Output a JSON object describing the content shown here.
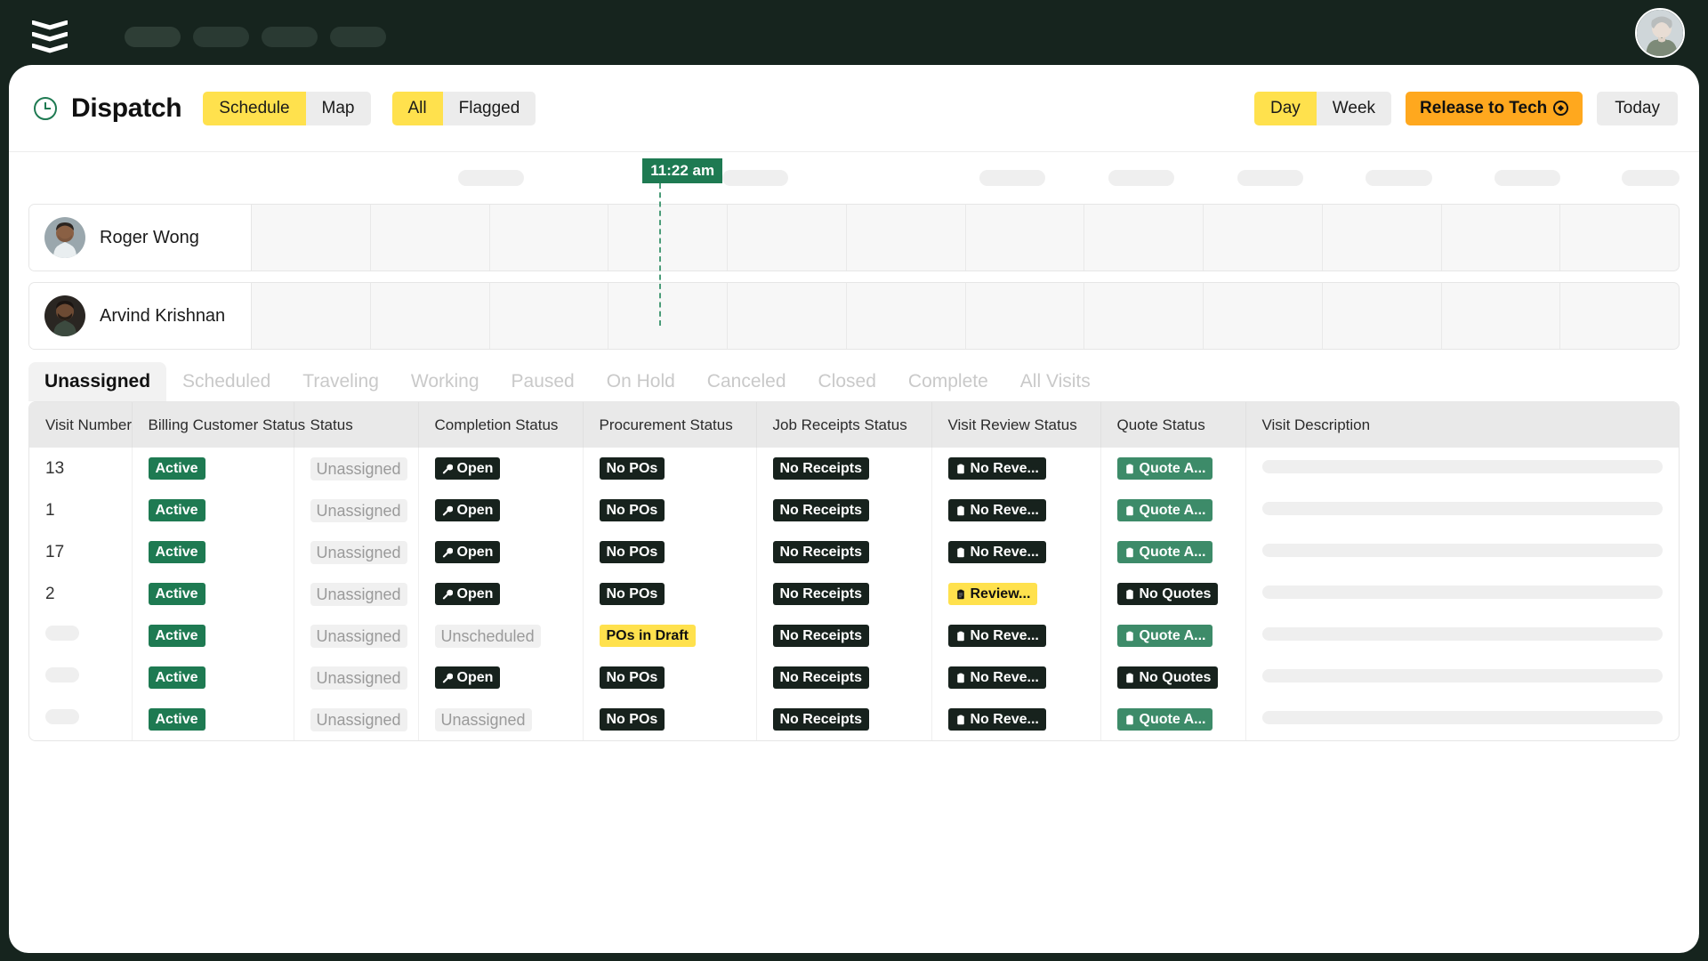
{
  "topbar": {
    "logo_name": "chevrons-logo",
    "nav_placeholders": 4,
    "avatar_label": "User avatar"
  },
  "header": {
    "clock_icon": "clock-icon",
    "title": "Dispatch",
    "view_toggle": {
      "options": [
        "Schedule",
        "Map"
      ],
      "selected": "Schedule"
    },
    "filter_toggle": {
      "options": [
        "All",
        "Flagged"
      ],
      "selected": "All"
    },
    "range_toggle": {
      "options": [
        "Day",
        "Week"
      ],
      "selected": "Day"
    },
    "release_button": {
      "label": "Release to Tech",
      "icon": "target-icon"
    },
    "today_button": {
      "label": "Today"
    }
  },
  "schedule": {
    "now_marker": {
      "time_label": "11:22 am",
      "left_pct": 37.3
    },
    "axis_pills": [
      {
        "left_pct": 26.0,
        "width_pct": 4.0
      },
      {
        "left_pct": 42.0,
        "width_pct": 4.0
      },
      {
        "left_pct": 57.6,
        "width_pct": 4.0
      },
      {
        "left_pct": 65.4,
        "width_pct": 4.0
      },
      {
        "left_pct": 73.2,
        "width_pct": 4.0
      },
      {
        "left_pct": 81.0,
        "width_pct": 4.0
      },
      {
        "left_pct": 88.8,
        "width_pct": 4.0
      },
      {
        "left_pct": 96.5,
        "width_pct": 3.5
      }
    ],
    "slot_count": 12,
    "technicians": [
      {
        "name": "Roger Wong",
        "avatar": "technician-avatar"
      },
      {
        "name": "Arvind Krishnan",
        "avatar": "technician-avatar"
      }
    ]
  },
  "status_tabs": {
    "items": [
      "Unassigned",
      "Scheduled",
      "Traveling",
      "Working",
      "Paused",
      "On Hold",
      "Canceled",
      "Closed",
      "Complete",
      "All Visits"
    ],
    "selected": "Unassigned"
  },
  "table": {
    "columns": [
      "Visit Number",
      "Billing Customer Status",
      "Status",
      "Completion Status",
      "Procurement Status",
      "Job Receipts Status",
      "Visit Review Status",
      "Quote Status",
      "Visit Description"
    ],
    "rows": [
      {
        "visit_number": "13",
        "visit_number_skeleton": false,
        "billing_customer_status": {
          "text": "Active",
          "style": "green"
        },
        "status": {
          "text": "Unassigned",
          "style": "muted"
        },
        "completion_status": {
          "text": "Open",
          "style": "dark",
          "icon": "wrench-icon"
        },
        "procurement_status": {
          "text": "No POs",
          "style": "dark"
        },
        "job_receipts_status": {
          "text": "No Receipts",
          "style": "dark"
        },
        "visit_review_status": {
          "text": "No Reve...",
          "style": "dark",
          "icon": "clipboard-icon"
        },
        "quote_status": {
          "text": "Quote A...",
          "style": "green-soft",
          "icon": "clipboard-icon"
        },
        "visit_description": {
          "skeleton": true
        }
      },
      {
        "visit_number": "1",
        "visit_number_skeleton": false,
        "billing_customer_status": {
          "text": "Active",
          "style": "green"
        },
        "status": {
          "text": "Unassigned",
          "style": "muted"
        },
        "completion_status": {
          "text": "Open",
          "style": "dark",
          "icon": "wrench-icon"
        },
        "procurement_status": {
          "text": "No POs",
          "style": "dark"
        },
        "job_receipts_status": {
          "text": "No Receipts",
          "style": "dark"
        },
        "visit_review_status": {
          "text": "No Reve...",
          "style": "dark",
          "icon": "clipboard-icon"
        },
        "quote_status": {
          "text": "Quote A...",
          "style": "green-soft",
          "icon": "clipboard-icon"
        },
        "visit_description": {
          "skeleton": true
        }
      },
      {
        "visit_number": "17",
        "visit_number_skeleton": false,
        "billing_customer_status": {
          "text": "Active",
          "style": "green"
        },
        "status": {
          "text": "Unassigned",
          "style": "muted"
        },
        "completion_status": {
          "text": "Open",
          "style": "dark",
          "icon": "wrench-icon"
        },
        "procurement_status": {
          "text": "No POs",
          "style": "dark"
        },
        "job_receipts_status": {
          "text": "No Receipts",
          "style": "dark"
        },
        "visit_review_status": {
          "text": "No Reve...",
          "style": "dark",
          "icon": "clipboard-icon"
        },
        "quote_status": {
          "text": "Quote A...",
          "style": "green-soft",
          "icon": "clipboard-icon"
        },
        "visit_description": {
          "skeleton": true
        }
      },
      {
        "visit_number": "2",
        "visit_number_skeleton": false,
        "billing_customer_status": {
          "text": "Active",
          "style": "green"
        },
        "status": {
          "text": "Unassigned",
          "style": "muted"
        },
        "completion_status": {
          "text": "Open",
          "style": "dark",
          "icon": "wrench-icon"
        },
        "procurement_status": {
          "text": "No POs",
          "style": "dark"
        },
        "job_receipts_status": {
          "text": "No Receipts",
          "style": "dark"
        },
        "visit_review_status": {
          "text": "Review...",
          "style": "yellow",
          "icon": "clipboard-icon"
        },
        "quote_status": {
          "text": "No Quotes",
          "style": "dark",
          "icon": "clipboard-icon"
        },
        "visit_description": {
          "skeleton": true
        }
      },
      {
        "visit_number": "",
        "visit_number_skeleton": true,
        "billing_customer_status": {
          "text": "Active",
          "style": "green"
        },
        "status": {
          "text": "Unassigned",
          "style": "muted"
        },
        "completion_status": {
          "text": "Unscheduled",
          "style": "muted"
        },
        "procurement_status": {
          "text": "POs in Draft",
          "style": "yellow"
        },
        "job_receipts_status": {
          "text": "No Receipts",
          "style": "dark"
        },
        "visit_review_status": {
          "text": "No Reve...",
          "style": "dark",
          "icon": "clipboard-icon"
        },
        "quote_status": {
          "text": "Quote A...",
          "style": "green-soft",
          "icon": "clipboard-icon"
        },
        "visit_description": {
          "skeleton": true
        }
      },
      {
        "visit_number": "",
        "visit_number_skeleton": true,
        "billing_customer_status": {
          "text": "Active",
          "style": "green"
        },
        "status": {
          "text": "Unassigned",
          "style": "muted"
        },
        "completion_status": {
          "text": "Open",
          "style": "dark",
          "icon": "wrench-icon"
        },
        "procurement_status": {
          "text": "No POs",
          "style": "dark"
        },
        "job_receipts_status": {
          "text": "No Receipts",
          "style": "dark"
        },
        "visit_review_status": {
          "text": "No Reve...",
          "style": "dark",
          "icon": "clipboard-icon"
        },
        "quote_status": {
          "text": "No Quotes",
          "style": "dark",
          "icon": "clipboard-icon"
        },
        "visit_description": {
          "skeleton": true
        }
      },
      {
        "visit_number": "",
        "visit_number_skeleton": true,
        "billing_customer_status": {
          "text": "Active",
          "style": "green"
        },
        "status": {
          "text": "Unassigned",
          "style": "muted"
        },
        "completion_status": {
          "text": "Unassigned",
          "style": "muted"
        },
        "procurement_status": {
          "text": "No POs",
          "style": "dark"
        },
        "job_receipts_status": {
          "text": "No Receipts",
          "style": "dark"
        },
        "visit_review_status": {
          "text": "No Reve...",
          "style": "dark",
          "icon": "clipboard-icon"
        },
        "quote_status": {
          "text": "Quote A...",
          "style": "green-soft",
          "icon": "clipboard-icon"
        },
        "visit_description": {
          "skeleton": true
        }
      }
    ]
  },
  "colors": {
    "brand_dark": "#16241e",
    "accent_yellow": "#ffe14d",
    "accent_orange": "#ffa81e",
    "status_green": "#1e7a52",
    "badge_dark": "#17221d"
  }
}
